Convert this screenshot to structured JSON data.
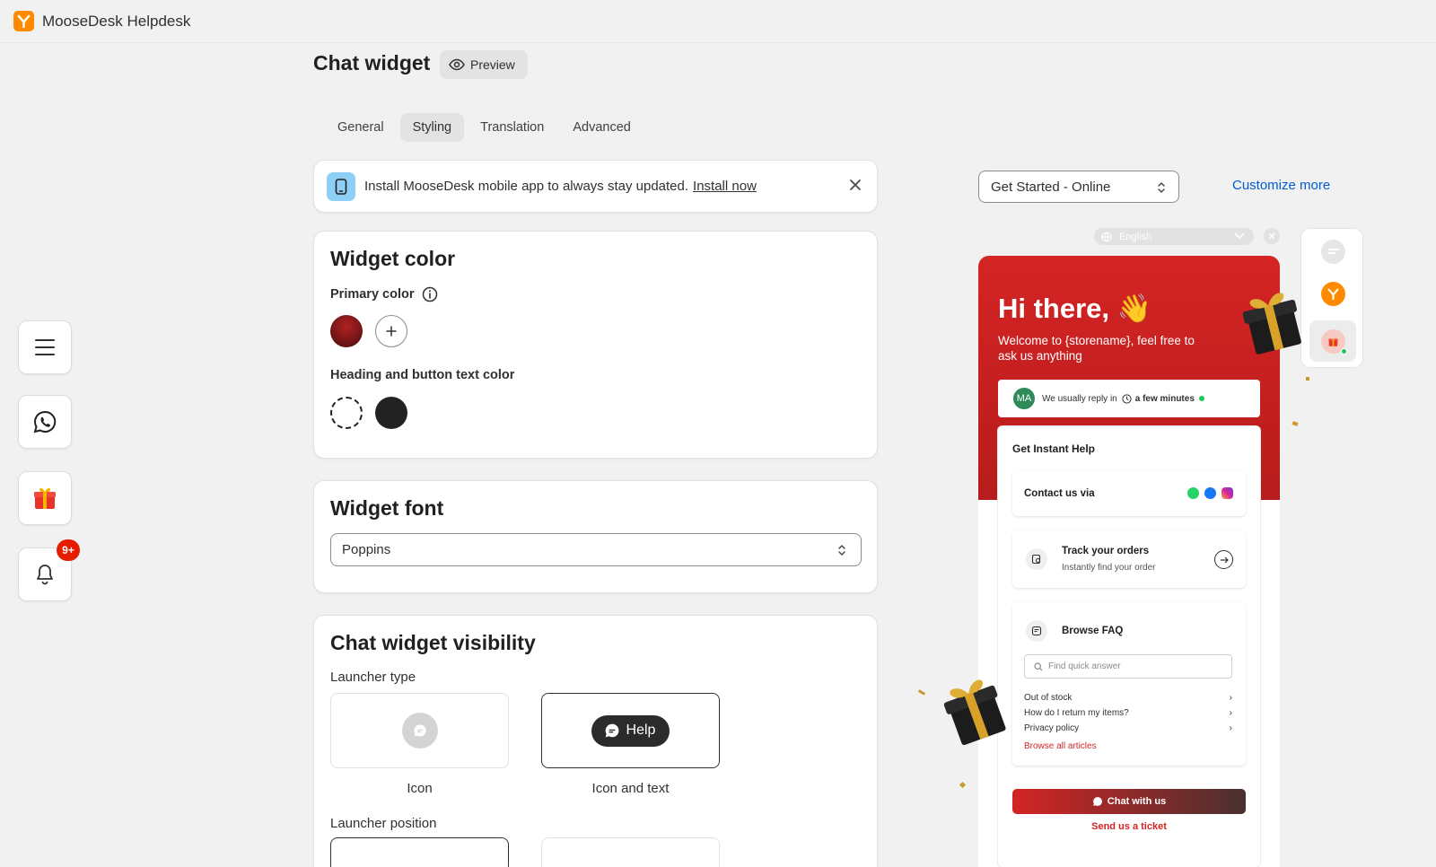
{
  "app": {
    "title": "MooseDesk Helpdesk"
  },
  "page": {
    "title": "Chat widget",
    "preview_label": "Preview"
  },
  "tabs": [
    {
      "label": "General",
      "active": false
    },
    {
      "label": "Styling",
      "active": true
    },
    {
      "label": "Translation",
      "active": false
    },
    {
      "label": "Advanced",
      "active": false
    }
  ],
  "sidebar": {
    "notification_count": "9+"
  },
  "banner": {
    "text": "Install MooseDesk mobile app to always stay updated.",
    "link": "Install now"
  },
  "widget_color": {
    "title": "Widget color",
    "primary_label": "Primary color",
    "primary_color": "#7a1414",
    "heading_label": "Heading and button text color",
    "text_colors": [
      "#ffffff",
      "#222222"
    ]
  },
  "widget_font": {
    "title": "Widget font",
    "value": "Poppins"
  },
  "visibility": {
    "title": "Chat widget visibility",
    "launcher_type_label": "Launcher type",
    "options": [
      {
        "caption": "Icon",
        "selected": false
      },
      {
        "caption": "Icon and text",
        "selected": true,
        "button_text": "Help"
      }
    ],
    "launcher_position_label": "Launcher position"
  },
  "preview": {
    "status_select": "Get Started - Online",
    "customize_link": "Customize more",
    "language": "English",
    "greeting": "Hi there,",
    "welcome": "Welcome to {storename}, feel free to ask us anything",
    "avatar_initials": "MA",
    "reply_prefix": "We usually reply in",
    "reply_time": "a few minutes",
    "instant_help": "Get Instant Help",
    "contact_label": "Contact us via",
    "track_title": "Track your orders",
    "track_sub": "Instantly find your order",
    "faq_title": "Browse FAQ",
    "faq_placeholder": "Find quick answer",
    "faq_items": [
      "Out of stock",
      "How do I return my items?",
      "Privacy policy"
    ],
    "faq_more": "Browse all articles",
    "chat_button": "Chat with us",
    "ticket_link": "Send us a ticket"
  },
  "colors": {
    "brand_red": "#d42424",
    "link_blue": "#005bd3",
    "orange": "#ff8a00"
  }
}
